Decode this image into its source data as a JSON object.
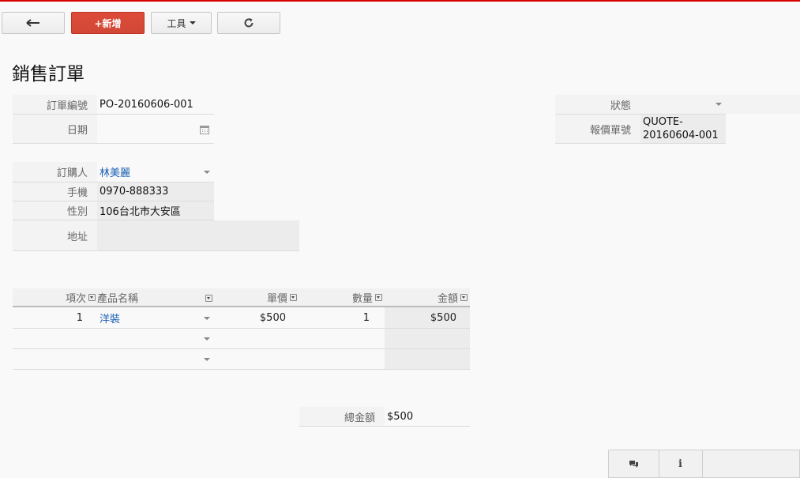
{
  "toolbar": {
    "back_icon": "arrow-left-icon",
    "new_label": "+新增",
    "tools_label": "工具",
    "refresh_icon": "refresh-icon"
  },
  "page_title": "銷售訂單",
  "order": {
    "order_no_label": "訂單編號",
    "order_no_value": "PO-20160606-001",
    "date_label": "日期",
    "date_value": "",
    "status_label": "狀態",
    "status_value": "",
    "quote_no_label": "報價單號",
    "quote_no_value_line1": "QUOTE-",
    "quote_no_value_line2": "20160604-001"
  },
  "buyer": {
    "buyer_label": "訂購人",
    "buyer_value": "林美麗",
    "phone_label": "手機",
    "phone_value": "0970-888333",
    "gender_label": "性別",
    "gender_value": "106台北市大安區",
    "address_label": "地址",
    "address_value": ""
  },
  "items_table": {
    "headers": {
      "index": "項次",
      "product": "產品名稱",
      "price": "單價",
      "qty": "數量",
      "amount": "金額"
    },
    "rows": [
      {
        "index": "1",
        "product": "洋裝",
        "price": "$500",
        "qty": "1",
        "amount": "$500"
      },
      {
        "index": "",
        "product": "",
        "price": "",
        "qty": "",
        "amount": ""
      },
      {
        "index": "",
        "product": "",
        "price": "",
        "qty": "",
        "amount": ""
      }
    ]
  },
  "total": {
    "label": "總金額",
    "value": "$500"
  },
  "bottom_bar": {
    "comment_icon": "comment-icon",
    "info_icon": "info-icon"
  },
  "colors": {
    "accent_red": "#dd4b39",
    "top_border": "#d90000",
    "link": "#1a5fb4"
  }
}
